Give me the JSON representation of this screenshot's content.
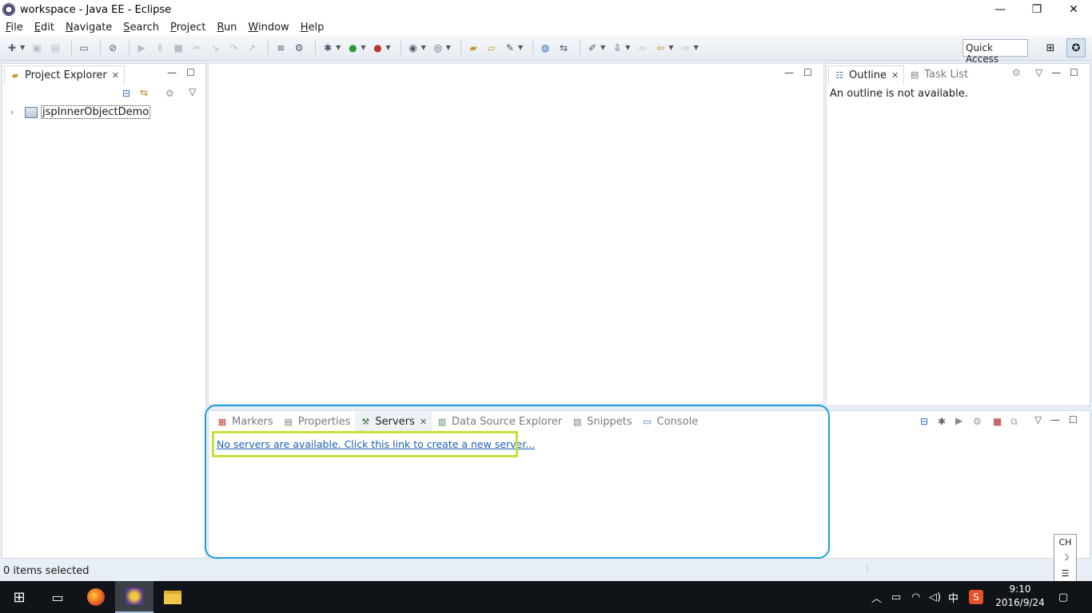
{
  "window": {
    "title": "workspace - Java EE - Eclipse",
    "minimize_glyph": "—",
    "restore_glyph": "❐",
    "close_glyph": "✕"
  },
  "menu": {
    "items": [
      {
        "first": "F",
        "rest": "ile"
      },
      {
        "first": "E",
        "rest": "dit"
      },
      {
        "first": "N",
        "rest": "avigate"
      },
      {
        "first": "",
        "rest": "Search",
        "u": "S"
      },
      {
        "first": "P",
        "rest": "roject"
      },
      {
        "first": "R",
        "rest": "un"
      },
      {
        "first": "W",
        "rest": "indow"
      },
      {
        "first": "H",
        "rest": "elp"
      }
    ]
  },
  "toolbar": {
    "quick_access": "Quick Access"
  },
  "project_explorer": {
    "tab_label": "Project Explorer",
    "tree": [
      {
        "label": "jspInnerObjectDemo"
      }
    ]
  },
  "outline": {
    "tab_label": "Outline",
    "task_list_label": "Task List",
    "message": "An outline is not available."
  },
  "bottom_panel": {
    "tabs": [
      {
        "label": "Markers",
        "active": false
      },
      {
        "label": "Properties",
        "active": false
      },
      {
        "label": "Servers",
        "active": true
      },
      {
        "label": "Data Source Explorer",
        "active": false
      },
      {
        "label": "Snippets",
        "active": false
      },
      {
        "label": "Console",
        "active": false
      }
    ],
    "servers_link": "No servers are available. Click this link to create a new server..."
  },
  "status": {
    "selection": "0 items selected"
  },
  "ime": {
    "lang": "CH",
    "moon": "☽",
    "menu": "☰"
  },
  "taskbar": {
    "tray_input": "中",
    "time": "9:10",
    "date": "2016/9/24"
  },
  "colors": {
    "highlight_blue": "#1fa0dc",
    "highlight_green": "#c6e03c",
    "link": "#1d5fb4"
  }
}
